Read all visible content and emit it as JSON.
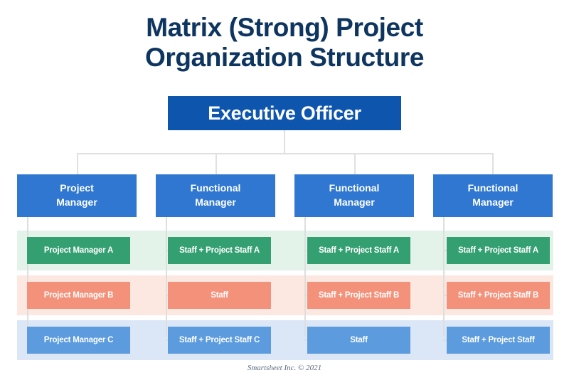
{
  "title": {
    "line1": "Matrix (Strong) Project",
    "line2": "Organization Structure",
    "color": "#0d3560"
  },
  "executive": {
    "label": "Executive Officer",
    "color": "#0e55ae"
  },
  "managers": [
    {
      "line1": "Project",
      "line2": "Manager"
    },
    {
      "line1": "Functional",
      "line2": "Manager"
    },
    {
      "line1": "Functional",
      "line2": "Manager"
    },
    {
      "line1": "Functional",
      "line2": "Manager"
    }
  ],
  "manager_color": "#2f77d0",
  "rows": [
    {
      "name": "row-a",
      "band_color": "#e3f3ea",
      "box_color": "#34a072",
      "cells": [
        "Project Manager A",
        "Staff + Project Staff A",
        "Staff + Project Staff A",
        "Staff + Project Staff A"
      ]
    },
    {
      "name": "row-b",
      "band_color": "#fde8e1",
      "box_color": "#f4917a",
      "cells": [
        "Project Manager B",
        "Staff",
        "Staff + Project Staff B",
        "Staff + Project Staff B"
      ]
    },
    {
      "name": "row-c",
      "band_color": "#dbe7f7",
      "box_color": "#5b9bde",
      "cells": [
        "Project Manager C",
        "Staff + Project Staff C",
        "Staff",
        "Staff + Project Staff"
      ]
    }
  ],
  "footer": {
    "text": "Smartsheet Inc. © 2021"
  },
  "connector_color": "#dedede"
}
